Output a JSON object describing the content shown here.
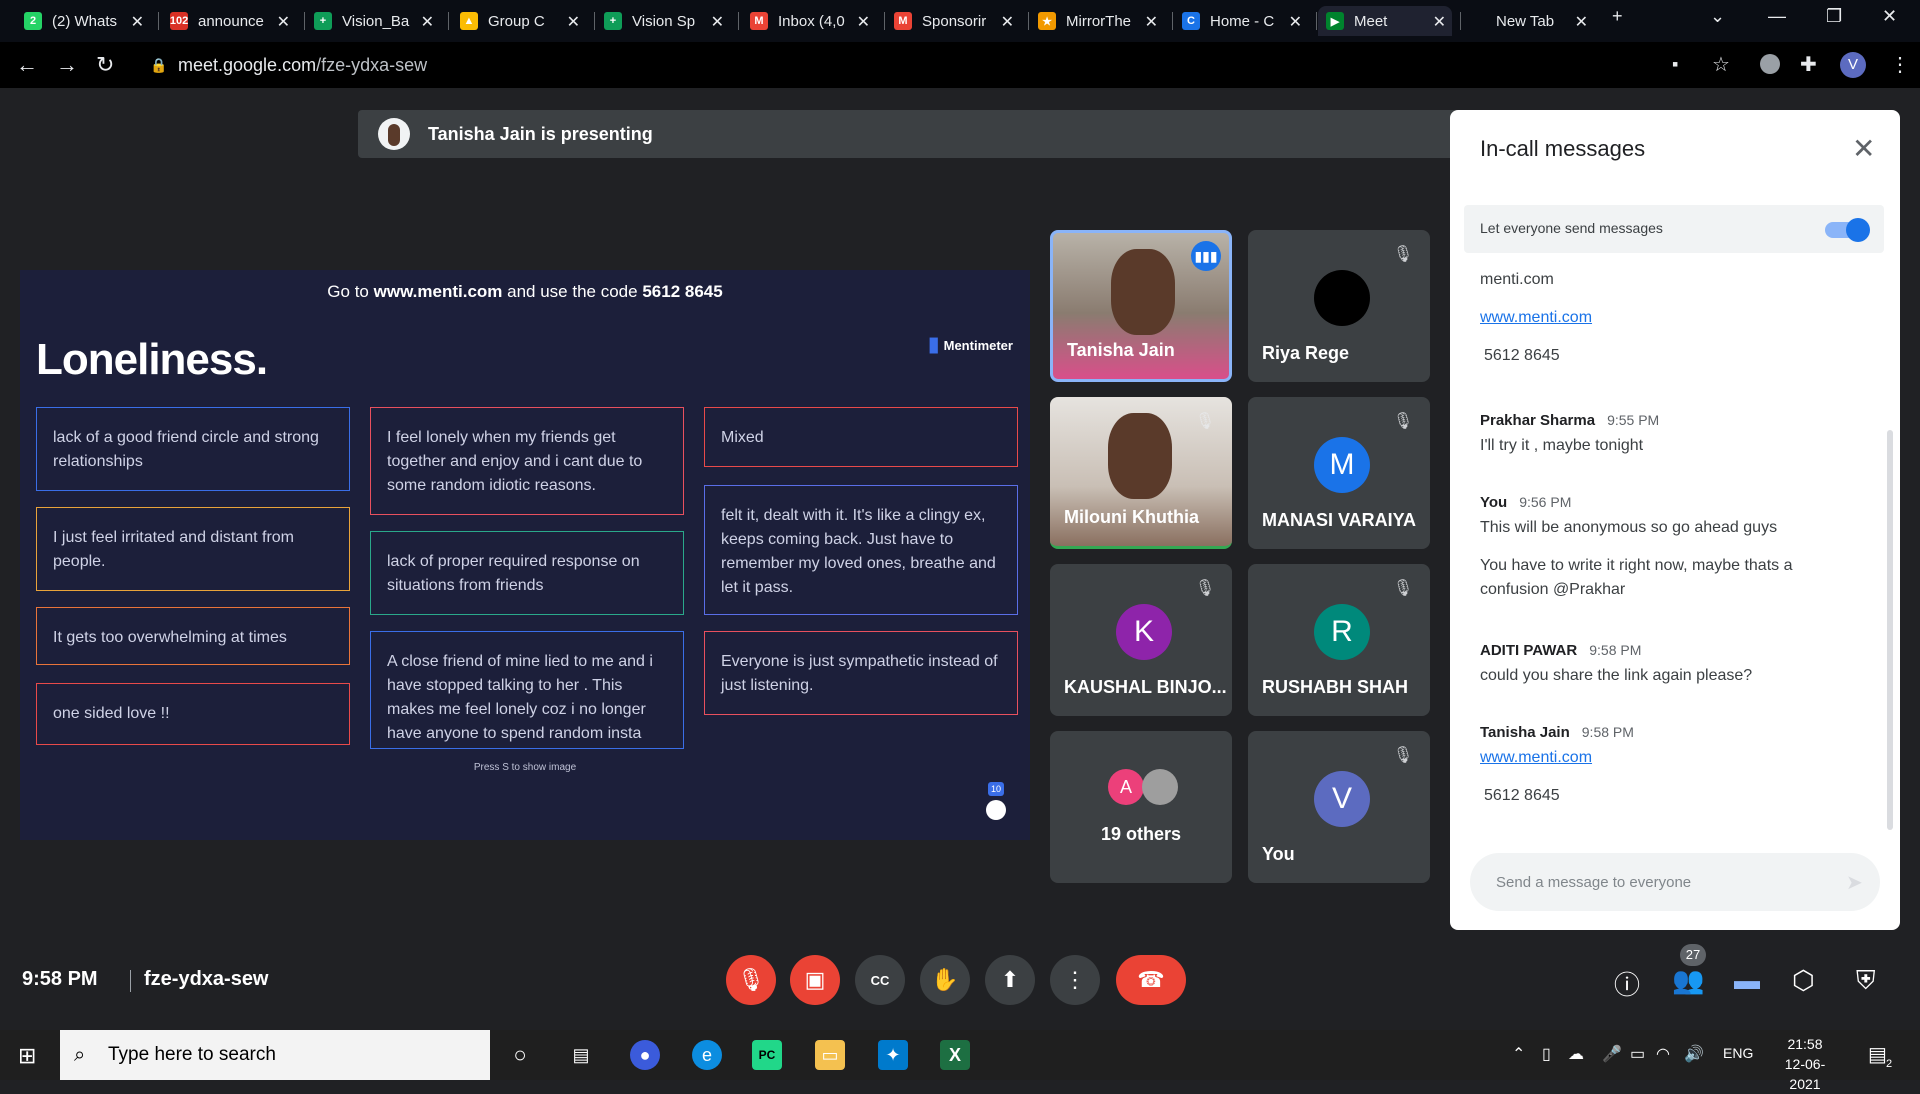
{
  "browser": {
    "tabs": [
      {
        "title": "(2) Whats",
        "favicon_color": "#25d366",
        "favicon_text": "2"
      },
      {
        "title": "announce",
        "favicon_color": "#d93025",
        "favicon_text": "102"
      },
      {
        "title": "Vision_Ba",
        "favicon_color": "#0f9d58",
        "favicon_text": "+"
      },
      {
        "title": "Group C",
        "favicon_color": "#fbbc04",
        "favicon_text": "▲"
      },
      {
        "title": "Vision Sp",
        "favicon_color": "#0f9d58",
        "favicon_text": "+"
      },
      {
        "title": "Inbox (4,0",
        "favicon_color": "#ea4335",
        "favicon_text": "M"
      },
      {
        "title": "Sponsorir",
        "favicon_color": "#ea4335",
        "favicon_text": "M"
      },
      {
        "title": "MirrorThe",
        "favicon_color": "#f29900",
        "favicon_text": "★"
      },
      {
        "title": "Home - C",
        "favicon_color": "#1a73e8",
        "favicon_text": "C"
      },
      {
        "title": "Meet",
        "favicon_color": "#00832d",
        "favicon_text": "▶"
      },
      {
        "title": "New Tab",
        "favicon_color": "#0a0d14",
        "favicon_text": ""
      }
    ],
    "url_host": "meet.google.com",
    "url_path": "/fze-ydxa-sew"
  },
  "presenting": {
    "text": "Tanisha Jain is presenting"
  },
  "slide": {
    "instruction_prefix": "Go to",
    "instruction_site": "www.menti.com",
    "instruction_middle": "and use the code",
    "instruction_code": "5612 8645",
    "title": "Loneliness.",
    "logo": "Mentimeter",
    "hint": "Press S to show image",
    "count": "10",
    "cards": [
      {
        "text": "lack of a good friend circle and strong relationships",
        "color": "#3a6ee8"
      },
      {
        "text": "I just feel irritated and distant from people.",
        "color": "#e8a33a"
      },
      {
        "text": "It gets too overwhelming at times",
        "color": "#e8743a"
      },
      {
        "text": "one sided love !!",
        "color": "#e84a4a"
      },
      {
        "text": "I feel lonely when my friends get together and enjoy and i cant due to some random idiotic reasons.",
        "color": "#e8505e"
      },
      {
        "text": "lack of proper required response on situations from friends",
        "color": "#2aa88a"
      },
      {
        "text": "A close friend of mine lied to me and i have stopped talking to her . This makes me feel lonely coz i no longer have anyone to spend random insta",
        "color": "#3a6ee8"
      },
      {
        "text": "Mixed",
        "color": "#e84a4a"
      },
      {
        "text": "felt it, dealt with it. It's like a clingy ex, keeps coming back. Just have to remember my loved ones, breathe and let it pass.",
        "color": "#5a6ee8"
      },
      {
        "text": "Everyone is just sympathetic instead of just listening.",
        "color": "#e8505e"
      }
    ]
  },
  "participants": [
    {
      "name": "Tanisha Jain",
      "avatar": "",
      "avatar_color": "",
      "muted": false,
      "video": true
    },
    {
      "name": "Riya Rege",
      "avatar": "",
      "avatar_color": "#000000",
      "muted": true,
      "video": false
    },
    {
      "name": "Milouni Khuthia",
      "avatar": "",
      "avatar_color": "",
      "muted": true,
      "video": true
    },
    {
      "name": "MANASI VARAIYA",
      "avatar": "M",
      "avatar_color": "#1a73e8",
      "muted": true,
      "video": false
    },
    {
      "name": "KAUSHAL BINJO...",
      "avatar": "K",
      "avatar_color": "#8e24aa",
      "muted": true,
      "video": false
    },
    {
      "name": "RUSHABH SHAH",
      "avatar": "R",
      "avatar_color": "#00897b",
      "muted": true,
      "video": false
    },
    {
      "name": "19 others",
      "avatar": "A",
      "avatar_color": "#ec407a",
      "muted": false,
      "video": false
    },
    {
      "name": "You",
      "avatar": "V",
      "avatar_color": "#5c6bc0",
      "muted": true,
      "video": false
    }
  ],
  "chat": {
    "title": "In-call messages",
    "toggle_label": "Let everyone send messages",
    "toggle_on": true,
    "messages_top": [
      "menti.com",
      "www.menti.com",
      "5612 8645"
    ],
    "messages": [
      {
        "sender": "Prakhar Sharma",
        "time": "9:55 PM",
        "lines": [
          "I'll try it , maybe tonight"
        ]
      },
      {
        "sender": "You",
        "time": "9:56 PM",
        "lines": [
          "This will be anonymous so go ahead guys",
          "You have to write it right now, maybe thats a confusion @Prakhar"
        ]
      },
      {
        "sender": "ADITI PAWAR",
        "time": "9:58 PM",
        "lines": [
          "could you share the link again please?"
        ]
      },
      {
        "sender": "Tanisha Jain",
        "time": "9:58 PM",
        "lines": [
          "www.menti.com",
          "5612 8645"
        ]
      }
    ],
    "input_placeholder": "Send a message to everyone"
  },
  "bottom_bar": {
    "time": "9:58 PM",
    "meeting_code": "fze-ydxa-sew",
    "people_count": "27"
  },
  "taskbar": {
    "search_placeholder": "Type here to search",
    "language": "ENG",
    "time": "21:58",
    "date": "12-06-2021",
    "notification_count": "2"
  }
}
